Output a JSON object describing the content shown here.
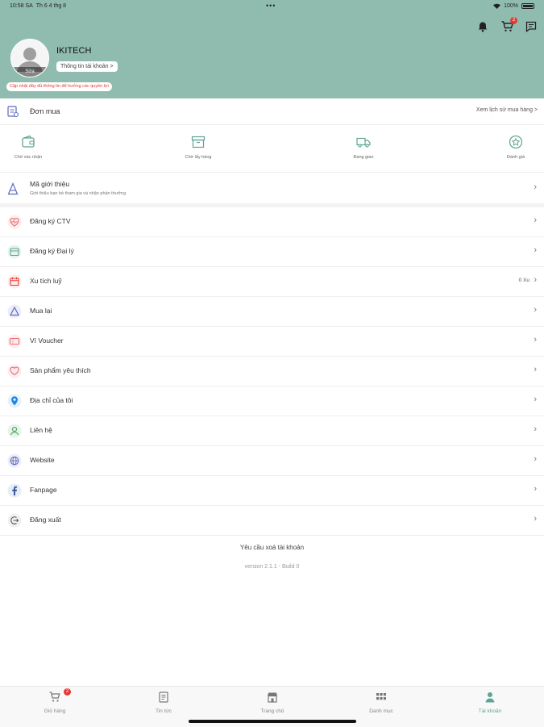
{
  "status_bar": {
    "time": "10:58 SA",
    "date": "Th 6 4 thg 8",
    "battery": "100%"
  },
  "colors": {
    "header_bg": "#90bcb0",
    "accent": "#5fa394",
    "badge": "#e53935"
  },
  "header": {
    "cart_badge": "2",
    "username": "IKITECH",
    "account_info_button": "Thông tin tài khoản >",
    "avatar_edit": "Sửa",
    "update_note": "Cập nhật đầy đủ thông tin để hưởng các quyền lợi"
  },
  "orders": {
    "label": "Đơn mua",
    "history_link": "Xem lịch sử mua hàng >",
    "statuses": [
      {
        "label": "Chờ xác nhận",
        "icon": "wallet-icon"
      },
      {
        "label": "Chờ lấy hàng",
        "icon": "box-icon"
      },
      {
        "label": "Đang giao",
        "icon": "truck-icon"
      },
      {
        "label": "Đánh giá",
        "icon": "star-icon"
      }
    ]
  },
  "referral": {
    "title": "Mã giới thiệu",
    "subtitle": "Giới thiệu bạn bè tham gia và nhận phần thưởng"
  },
  "menu": [
    {
      "label": "Đăng ký CTV",
      "icon": "heart-pulse-icon",
      "value": ""
    },
    {
      "label": "Đăng ký Đại lý",
      "icon": "store-icon",
      "value": ""
    },
    {
      "label": "Xu tích luỹ",
      "icon": "calendar-coin-icon",
      "value": "0 Xu"
    },
    {
      "label": "Mua lại",
      "icon": "bag-icon",
      "value": ""
    },
    {
      "label": "Ví Voucher",
      "icon": "voucher-icon",
      "value": ""
    },
    {
      "label": "Sản phẩm yêu thích",
      "icon": "heart-icon",
      "value": ""
    },
    {
      "label": "Địa chỉ của tôi",
      "icon": "location-pin-icon",
      "value": ""
    },
    {
      "label": "Liên hệ",
      "icon": "contact-icon",
      "value": ""
    },
    {
      "label": "Website",
      "icon": "globe-icon",
      "value": ""
    },
    {
      "label": "Fanpage",
      "icon": "facebook-icon",
      "value": ""
    },
    {
      "label": "Đăng xuất",
      "icon": "logout-icon",
      "value": ""
    }
  ],
  "delete_account": "Yêu cầu xoá tài khoản",
  "version": "version 2.1.1 - Build 0",
  "tabs": [
    {
      "label": "Giỏ hàng",
      "icon": "cart-icon",
      "badge": "2"
    },
    {
      "label": "Tin tức",
      "icon": "news-icon"
    },
    {
      "label": "Trang chủ",
      "icon": "home-store-icon"
    },
    {
      "label": "Danh mục",
      "icon": "grid-icon"
    },
    {
      "label": "Tài khoản",
      "icon": "person-icon",
      "active": true
    }
  ]
}
